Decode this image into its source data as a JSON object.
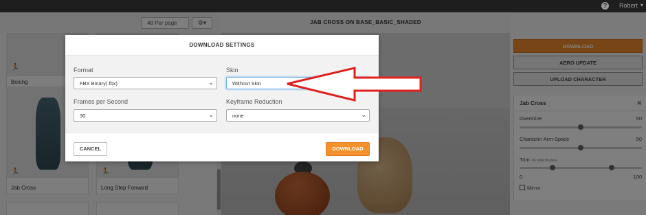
{
  "topbar": {
    "user": "Robert",
    "help_glyph": "?",
    "caret": "▾"
  },
  "browse": {
    "per_page": "48 Per page",
    "cards": [
      {
        "label": "Boxing"
      },
      {
        "label": "Jab Cross"
      },
      {
        "label": "Long Step Forward"
      }
    ]
  },
  "viewer": {
    "title": "JAB CROSS ON BASE_BASIC_SHADED"
  },
  "right_panel": {
    "download": "DOWNLOAD",
    "aero_update": "AERO UPDATE",
    "upload_character": "UPLOAD CHARACTER",
    "settings": {
      "title": "Jab Cross",
      "close_glyph": "✖",
      "params": [
        {
          "label": "Overdrive",
          "value": "50",
          "level": 0.5
        },
        {
          "label": "Character Arm-Space",
          "value": "50",
          "level": 0.5
        }
      ],
      "trim": {
        "label": "Trim",
        "sub": "65 total frames",
        "min": "0",
        "max": "100",
        "start": 0.27,
        "end": 0.75
      },
      "mirror": "Mirror"
    }
  },
  "modal": {
    "title": "DOWNLOAD SETTINGS",
    "format_label": "Format",
    "format_value": "FBX Binary(.fbx)",
    "skin_label": "Skin",
    "skin_value": "Without Skin",
    "fps_label": "Frames per Second",
    "fps_value": "30",
    "keyframe_label": "Keyframe Reduction",
    "keyframe_value": "none",
    "cancel": "CANCEL",
    "download": "DOWNLOAD"
  },
  "colors": {
    "accent": "#f5922e",
    "annotation": "#e0201c"
  },
  "icons": {
    "help": "help-icon",
    "gear": "gear-icon",
    "run": "running-figure-icon",
    "close": "close-icon"
  }
}
